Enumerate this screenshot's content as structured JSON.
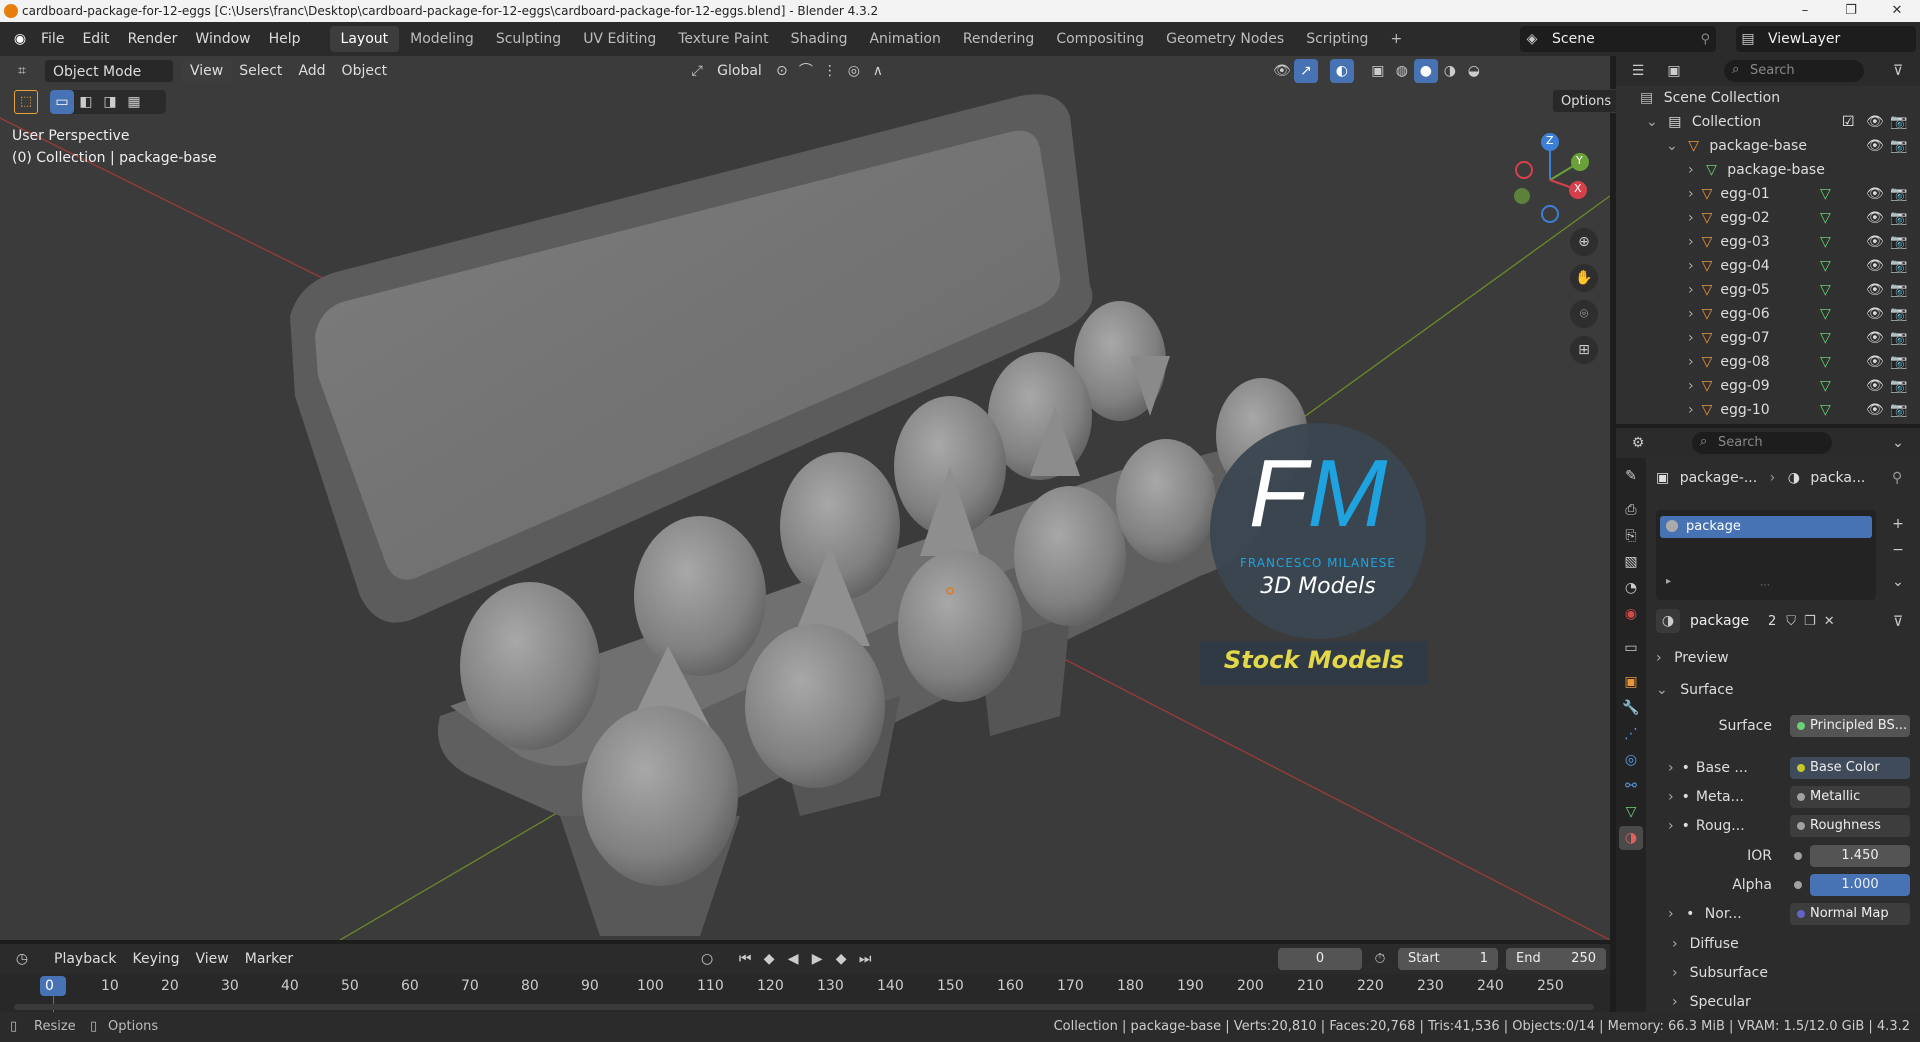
{
  "window": {
    "title": "cardboard-package-for-12-eggs [C:\\Users\\franc\\Desktop\\cardboard-package-for-12-eggs\\cardboard-package-for-12-eggs.blend] - Blender 4.3.2"
  },
  "menu": [
    "File",
    "Edit",
    "Render",
    "Window",
    "Help"
  ],
  "workspaces": [
    "Layout",
    "Modeling",
    "Sculpting",
    "UV Editing",
    "Texture Paint",
    "Shading",
    "Animation",
    "Rendering",
    "Compositing",
    "Geometry Nodes",
    "Scripting"
  ],
  "active_workspace": "Layout",
  "scene": {
    "name": "Scene",
    "view_layer": "ViewLayer"
  },
  "viewport": {
    "mode": "Object Mode",
    "menus": [
      "View",
      "Select",
      "Add",
      "Object"
    ],
    "transform_orientation": "Global",
    "options_label": "Options",
    "perspective_label": "User Perspective",
    "collection_label": "(0) Collection | package-base",
    "gizmo_axes": {
      "x": "X",
      "y": "Y",
      "z": "Z"
    }
  },
  "watermark": {
    "letters_f": "F",
    "letters_m": "M",
    "author": "FRANCESCO MILANESE",
    "subtitle": "3D Models",
    "banner": "Stock Models"
  },
  "outliner": {
    "search_placeholder": "Search",
    "scene_collection": "Scene Collection",
    "collection": "Collection",
    "parent": "package-base",
    "mesh": "package-base",
    "items": [
      "egg-01",
      "egg-02",
      "egg-03",
      "egg-04",
      "egg-05",
      "egg-06",
      "egg-07",
      "egg-08",
      "egg-09",
      "egg-10"
    ]
  },
  "properties": {
    "search_placeholder": "Search",
    "breadcrumb_object": "package-...",
    "breadcrumb_material": "packa...",
    "material_slot": "package",
    "material_name": "package",
    "users": "2",
    "panels": {
      "preview": "Preview",
      "surface": "Surface"
    },
    "surface_label": "Surface",
    "surface_value": "Principled BS...",
    "inputs": [
      {
        "label": "Base ...",
        "value": "Base Color",
        "color": "#c7c729"
      },
      {
        "label": "Meta...",
        "value": "Metallic",
        "color": "#a1a1a1"
      },
      {
        "label": "Roug...",
        "value": "Roughness",
        "color": "#a1a1a1"
      }
    ],
    "ior": {
      "label": "IOR",
      "value": "1.450"
    },
    "alpha": {
      "label": "Alpha",
      "value": "1.000"
    },
    "normal": {
      "label": "Nor...",
      "value": "Normal Map"
    },
    "subpanels": [
      "Diffuse",
      "Subsurface",
      "Specular"
    ]
  },
  "timeline": {
    "menus": [
      "Playback",
      "Keying",
      "View",
      "Marker"
    ],
    "current_frame": "0",
    "start_label": "Start",
    "start": "1",
    "end_label": "End",
    "end": "250",
    "ticks": [
      "0",
      "10",
      "20",
      "30",
      "40",
      "50",
      "60",
      "70",
      "80",
      "90",
      "100",
      "110",
      "120",
      "130",
      "140",
      "150",
      "160",
      "170",
      "180",
      "190",
      "200",
      "210",
      "220",
      "230",
      "240",
      "250"
    ]
  },
  "statusbar": {
    "left1": "Resize",
    "left2": "Options",
    "info": "Collection | package-base | Verts:20,810 | Faces:20,768 | Tris:41,536 | Objects:0/14 | Memory: 66.3 MiB | VRAM: 1.5/12.0 GiB | 4.3.2"
  },
  "colors": {
    "accent": "#4772b3",
    "mesh_icon": "#e9963b",
    "data_icon": "#6cd07a"
  }
}
